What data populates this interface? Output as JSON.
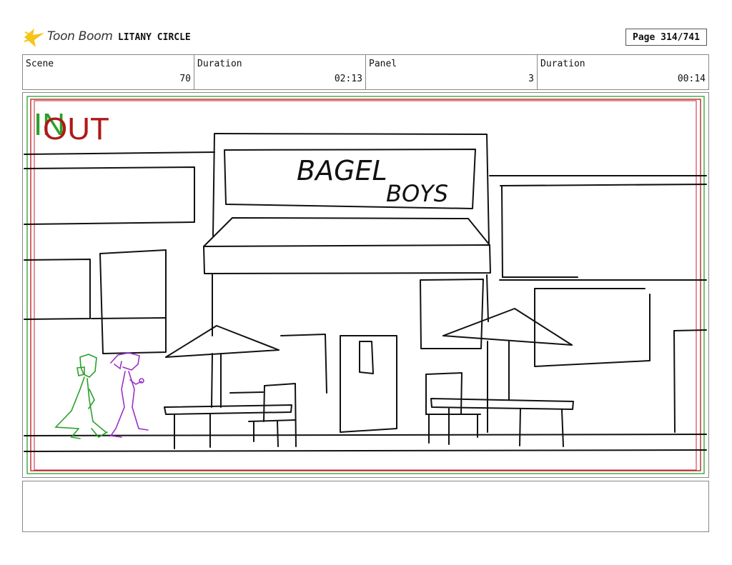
{
  "header": {
    "logo_text": "Toon Boom",
    "project_title": "LITANY CIRCLE",
    "page_label": "Page 314/741"
  },
  "info": {
    "scene_label": "Scene",
    "scene_value": "70",
    "duration_label": "Duration",
    "duration_value": "02:13",
    "panel_label": "Panel",
    "panel_value": "3",
    "panel_duration_label": "Duration",
    "panel_duration_value": "00:14"
  },
  "panel": {
    "in_label": "IN",
    "out_label": "OUT",
    "sign_line1": "BAGEL",
    "sign_line2": "BOYS"
  },
  "colors": {
    "in_green": "#2aa02a",
    "out_red": "#b01818",
    "char_green": "#2aa02a",
    "char_purple": "#9b30c8",
    "logo_yellow": "#f5c518"
  }
}
